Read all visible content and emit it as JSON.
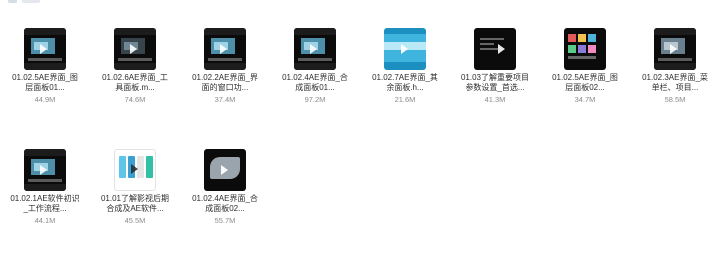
{
  "files": [
    {
      "name_lines": [
        "01.02.5AE界面_图",
        "层面板01..."
      ],
      "size": "44.9M",
      "thumb_icon": "video-thumbnail-icon"
    },
    {
      "name_lines": [
        "01.02.6AE界面_工",
        "具面板.m..."
      ],
      "size": "74.6M",
      "thumb_icon": "video-thumbnail-icon"
    },
    {
      "name_lines": [
        "01.02.2AE界面_界",
        "面的窗口功..."
      ],
      "size": "37.4M",
      "thumb_icon": "video-thumbnail-icon"
    },
    {
      "name_lines": [
        "01.02.4AE界面_合",
        "成面板01..."
      ],
      "size": "97.2M",
      "thumb_icon": "video-thumbnail-icon"
    },
    {
      "name_lines": [
        "01.02.7AE界面_其",
        "余面板.h..."
      ],
      "size": "21.6M",
      "thumb_icon": "video-thumbnail-icon"
    },
    {
      "name_lines": [
        "01.03了解重要项目",
        "参数设置_首选..."
      ],
      "size": "41.3M",
      "thumb_icon": "video-thumbnail-icon"
    },
    {
      "name_lines": [
        "01.02.5AE界面_图",
        "层面板02..."
      ],
      "size": "34.7M",
      "thumb_icon": "video-thumbnail-icon"
    },
    {
      "name_lines": [
        "01.02.3AE界面_菜",
        "单栏、项目..."
      ],
      "size": "58.5M",
      "thumb_icon": "video-thumbnail-icon"
    },
    {
      "name_lines": [
        "01.02.1AE软件初识",
        "_工作流程..."
      ],
      "size": "44.1M",
      "thumb_icon": "video-thumbnail-icon"
    },
    {
      "name_lines": [
        "01.01了解影视后期",
        "合成及AE软件..."
      ],
      "size": "45.5M",
      "thumb_icon": "video-thumbnail-icon"
    },
    {
      "name_lines": [
        "01.02.4AE界面_合",
        "成面板02..."
      ],
      "size": "55.7M",
      "thumb_icon": "video-thumbnail-icon"
    }
  ]
}
